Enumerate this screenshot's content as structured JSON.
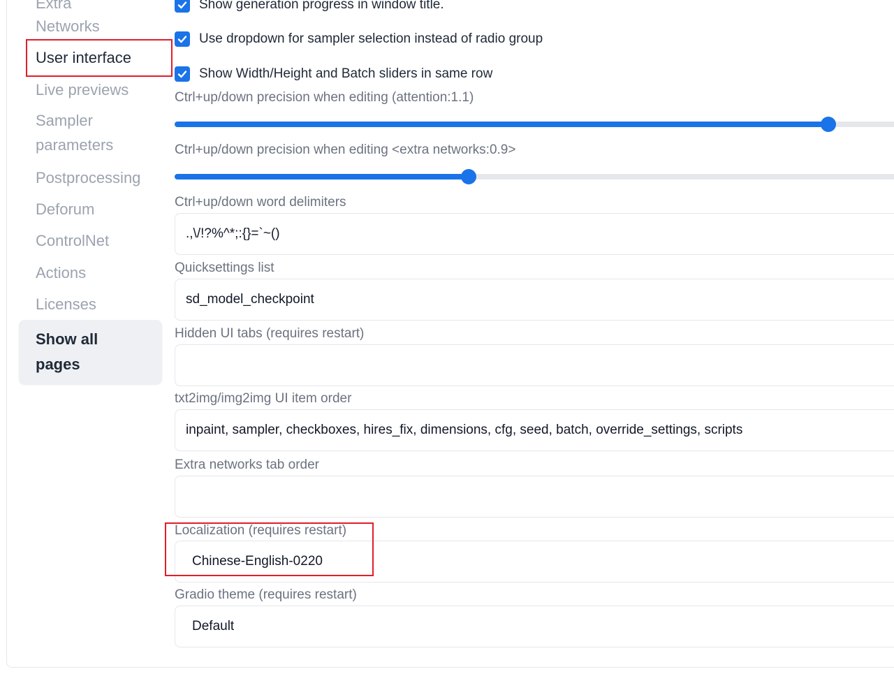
{
  "sidebar": {
    "items": [
      {
        "label": "Extra",
        "state": "inactive"
      },
      {
        "label": "Networks",
        "state": "inactive"
      },
      {
        "label": "User interface",
        "state": "active"
      },
      {
        "label": "Live previews",
        "state": "inactive"
      },
      {
        "label": "Sampler parameters",
        "state": "inactive"
      },
      {
        "label": "Postprocessing",
        "state": "inactive"
      },
      {
        "label": "Deforum",
        "state": "inactive"
      },
      {
        "label": "ControlNet",
        "state": "inactive"
      },
      {
        "label": "Actions",
        "state": "inactive"
      },
      {
        "label": "Licenses",
        "state": "inactive"
      }
    ],
    "show_all_label": "Show all pages"
  },
  "settings": {
    "checkboxes": [
      {
        "label": "Show generation progress in window title.",
        "checked": true
      },
      {
        "label": "Use dropdown for sampler selection instead of radio group",
        "checked": true
      },
      {
        "label": "Show Width/Height and Batch sliders in same row",
        "checked": true
      }
    ],
    "sliders": [
      {
        "label": "Ctrl+up/down precision when editing (attention:1.1)",
        "fraction": 0.9
      },
      {
        "label": "Ctrl+up/down precision when editing <extra networks:0.9>",
        "fraction": 0.405
      }
    ],
    "fields": [
      {
        "label": "Ctrl+up/down word delimiters",
        "value": ".,\\/!?%^*;:{}=`~()"
      },
      {
        "label": "Quicksettings list",
        "value": "sd_model_checkpoint"
      },
      {
        "label": "Hidden UI tabs (requires restart)",
        "value": ""
      },
      {
        "label": "txt2img/img2img UI item order",
        "value": "inpaint, sampler, checkboxes, hires_fix, dimensions, cfg, seed, batch, override_settings, scripts"
      },
      {
        "label": "Extra networks tab order",
        "value": ""
      }
    ],
    "dropdowns": [
      {
        "label": "Localization (requires restart)",
        "value": "Chinese-English-0220"
      },
      {
        "label": "Gradio theme (requires restart)",
        "value": "Default"
      }
    ]
  },
  "colors": {
    "accent": "#1a73e8",
    "highlight_box": "#e11d2a",
    "muted_text": "#9ca3af"
  }
}
